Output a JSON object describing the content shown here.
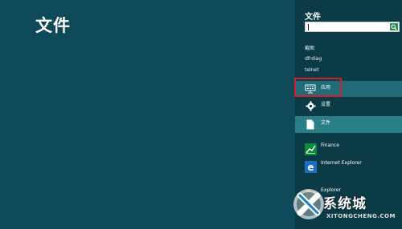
{
  "main": {
    "title": "文件"
  },
  "charm": {
    "title": "文件",
    "search": {
      "value": "",
      "placeholder": ""
    },
    "suggestions": [
      "截图",
      "dfrdiag",
      "telnet"
    ],
    "scopes": [
      {
        "label": "应用",
        "icon": "monitor-icon"
      },
      {
        "label": "设置",
        "icon": "gear-icon"
      },
      {
        "label": "文件",
        "icon": "document-icon"
      }
    ],
    "apps": [
      {
        "label": "Finance",
        "icon": "finance-chart-icon"
      },
      {
        "label": "Internet Explorer",
        "icon": "internet-explorer-icon"
      },
      {
        "label": "Explorer",
        "icon": "explorer-icon"
      }
    ]
  },
  "watermark": {
    "text": "系统城",
    "sub": "XITONGCHENG.COM"
  },
  "colors": {
    "background": "#0e4a5a",
    "charm_background": "#0b3b47",
    "selected_scope": "#2a7f86",
    "highlight_outline": "#d21f2a",
    "search_button": "#2e8b4f"
  }
}
